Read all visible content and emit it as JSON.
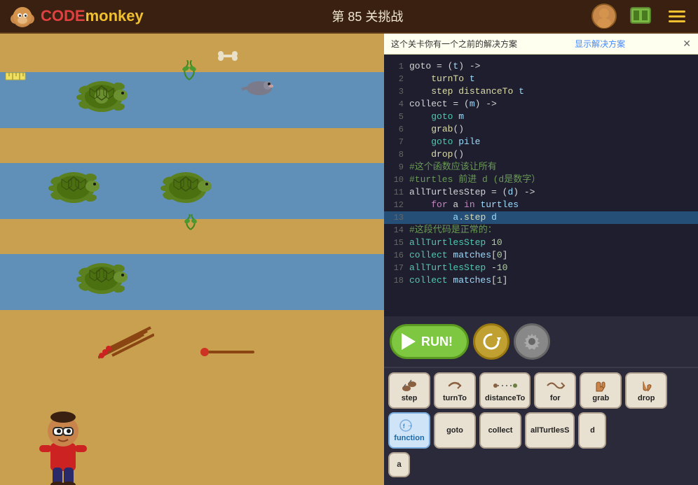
{
  "topbar": {
    "logo_code": "CODE",
    "logo_monkey": "monkey",
    "level_title": "第 85 关挑战"
  },
  "notice": {
    "text": "这个关卡你有一个之前的解决方案",
    "show_solution_label": "显示解决方案",
    "close_label": "✕"
  },
  "code": {
    "lines": [
      {
        "num": "1",
        "content": "goto = (t) ->",
        "class": ""
      },
      {
        "num": "2",
        "content": "    turnTo t",
        "class": ""
      },
      {
        "num": "3",
        "content": "    step distanceTo t",
        "class": ""
      },
      {
        "num": "4",
        "content": "collect = (m) ->",
        "class": ""
      },
      {
        "num": "5",
        "content": "    goto m",
        "class": ""
      },
      {
        "num": "6",
        "content": "    grab()",
        "class": ""
      },
      {
        "num": "7",
        "content": "    goto pile",
        "class": ""
      },
      {
        "num": "8",
        "content": "    drop()",
        "class": ""
      },
      {
        "num": "9",
        "content": "#这个函数应该让所有",
        "class": "comment"
      },
      {
        "num": "10",
        "content": "#turtles 前进 d (d是数字）",
        "class": "comment"
      },
      {
        "num": "11",
        "content": "allTurtlesStep = (d) ->",
        "class": ""
      },
      {
        "num": "12",
        "content": "    for a in turtles",
        "class": ""
      },
      {
        "num": "13",
        "content": "        a.step d",
        "class": "highlight"
      },
      {
        "num": "14",
        "content": "#这段代码是正常的：",
        "class": "comment"
      },
      {
        "num": "15",
        "content": "allTurtlesStep 10",
        "class": ""
      },
      {
        "num": "16",
        "content": "collect matches[0]",
        "class": ""
      },
      {
        "num": "17",
        "content": "allTurtlesStep -10",
        "class": ""
      },
      {
        "num": "18",
        "content": "collect matches[1]",
        "class": ""
      }
    ]
  },
  "run_bar": {
    "run_label": "RUN!"
  },
  "toolbar": {
    "row1": [
      {
        "icon": "👣",
        "label": "step",
        "style": "normal"
      },
      {
        "icon": "↩",
        "label": "turnTo",
        "style": "normal"
      },
      {
        "icon": "···",
        "label": "distanceTo",
        "style": "normal"
      },
      {
        "icon": "↩↩↩",
        "label": "for",
        "style": "normal"
      },
      {
        "icon": "✊",
        "label": "grab",
        "style": "normal"
      },
      {
        "icon": "👋",
        "label": "drop",
        "style": "normal"
      }
    ],
    "row2": [
      {
        "icon": "f→",
        "label": "function",
        "style": "blue"
      },
      {
        "icon": "",
        "label": "goto",
        "style": "normal"
      },
      {
        "icon": "",
        "label": "collect",
        "style": "normal"
      },
      {
        "icon": "",
        "label": "allTurtlesS",
        "style": "normal"
      },
      {
        "icon": "",
        "label": "d",
        "style": "normal"
      }
    ],
    "row3": [
      {
        "label": "a",
        "style": "tiny"
      }
    ]
  }
}
